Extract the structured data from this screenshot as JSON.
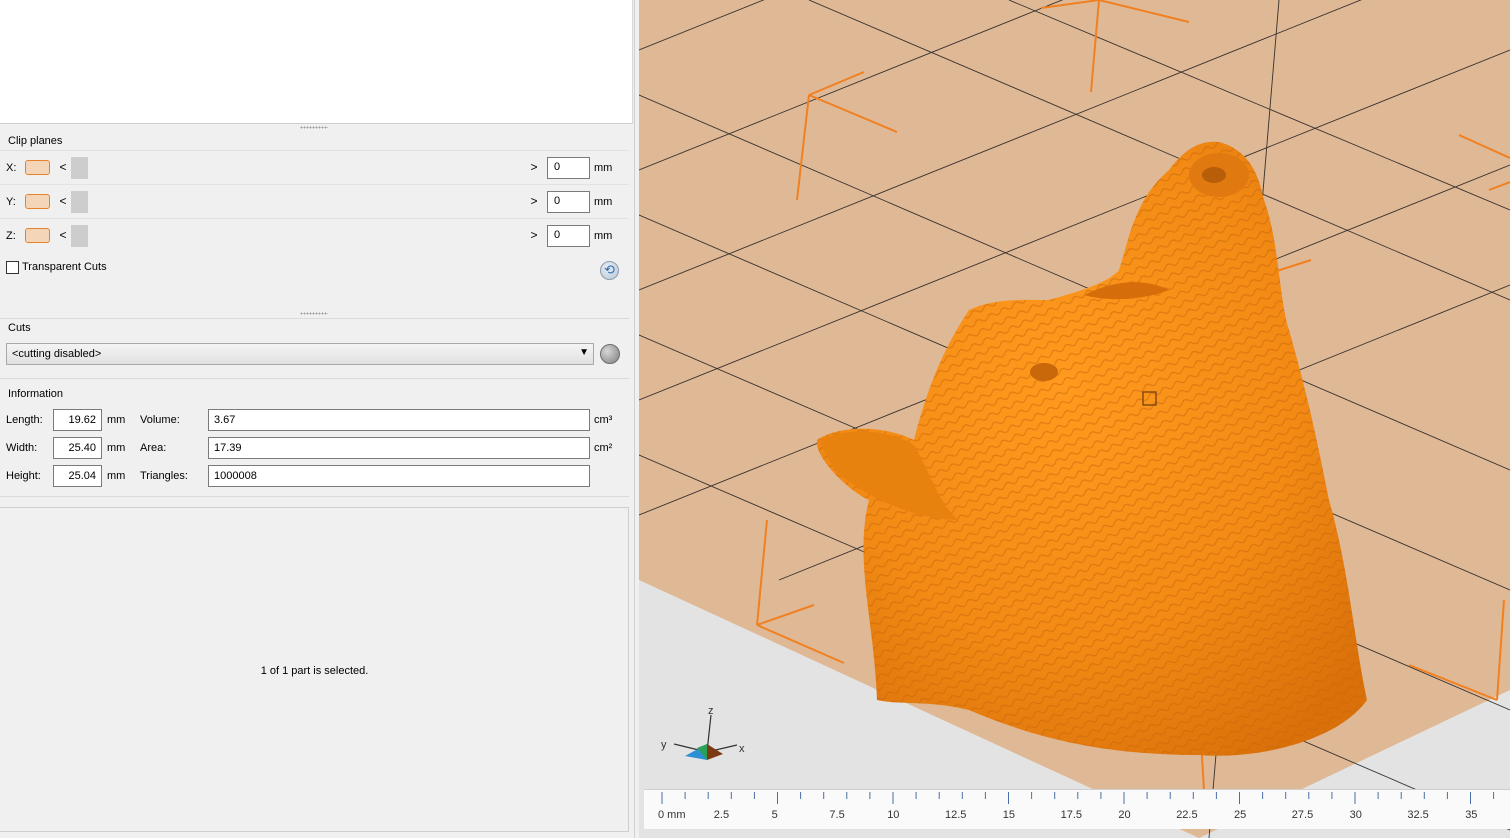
{
  "clip_planes": {
    "title": "Clip planes",
    "rows": [
      {
        "axis": "X:",
        "value": "0",
        "unit": "mm"
      },
      {
        "axis": "Y:",
        "value": "0",
        "unit": "mm"
      },
      {
        "axis": "Z:",
        "value": "0",
        "unit": "mm"
      }
    ],
    "arrow_left": "<",
    "arrow_right": ">",
    "transparent_label": "Transparent Cuts",
    "transparent_checked": false,
    "swatch_color": "#e8822a"
  },
  "cuts": {
    "title": "Cuts",
    "selected": "<cutting disabled>"
  },
  "information": {
    "title": "Information",
    "length_label": "Length:",
    "length": "19.62",
    "length_unit": "mm",
    "width_label": "Width:",
    "width": "25.40",
    "width_unit": "mm",
    "height_label": "Height:",
    "height": "25.04",
    "height_unit": "mm",
    "volume_label": "Volume:",
    "volume": "3.67",
    "volume_unit": "cm³",
    "area_label": "Area:",
    "area": "17.39",
    "area_unit": "cm²",
    "triangles_label": "Triangles:",
    "triangles": "1000008"
  },
  "selection": {
    "message": "1 of 1 part is selected."
  },
  "axes": {
    "x": "x",
    "y": "y",
    "z": "z"
  },
  "ruler": {
    "labels": [
      "0 mm",
      "2.5",
      "5",
      "7.5",
      "10",
      "12.5",
      "15",
      "17.5",
      "20",
      "22.5",
      "25",
      "27.5",
      "30",
      "32.5",
      "35"
    ]
  },
  "colors": {
    "model": "#f28a14",
    "plate": "#dfb896",
    "frame": "#f08020",
    "panel": "#f0f0f0"
  }
}
